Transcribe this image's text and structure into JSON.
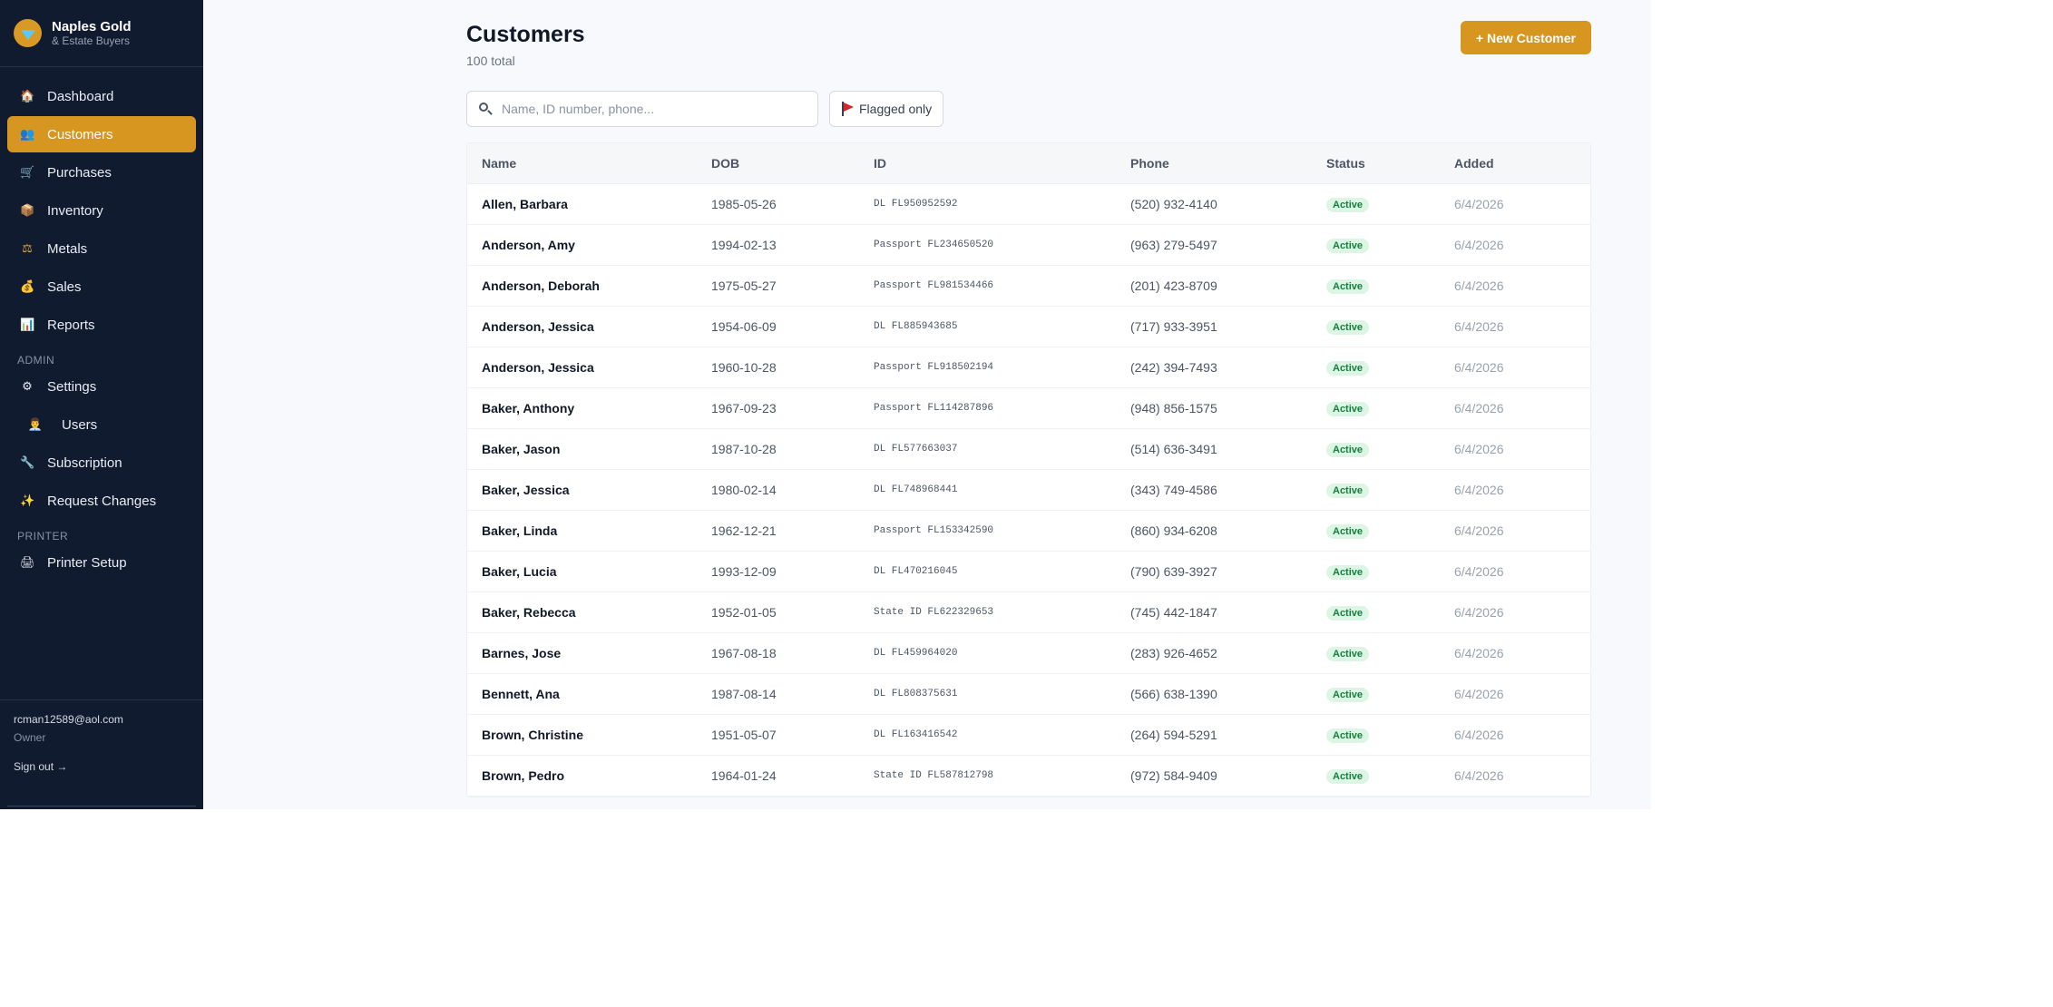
{
  "brand": {
    "name": "Naples Gold",
    "subtitle": "& Estate Buyers"
  },
  "sidebar": {
    "items": [
      {
        "label": "Dashboard",
        "icon": "🏠"
      },
      {
        "label": "Customers",
        "icon": "👥",
        "active": true
      },
      {
        "label": "Purchases",
        "icon": "🛒"
      },
      {
        "label": "Inventory",
        "icon": "📦"
      },
      {
        "label": "Metals",
        "icon": "⚖"
      },
      {
        "label": "Sales",
        "icon": "💰"
      },
      {
        "label": "Reports",
        "icon": "📊"
      }
    ],
    "admin_label": "ADMIN",
    "admin_items": [
      {
        "label": "Settings",
        "icon": "⚙"
      },
      {
        "label": "Users",
        "icon": "👨‍💼"
      },
      {
        "label": "Subscription",
        "icon": "🔧"
      },
      {
        "label": "Request Changes",
        "icon": "✨"
      }
    ],
    "printer_label": "PRINTER",
    "printer_items": [
      {
        "label": "Printer Setup",
        "icon": "🖨"
      }
    ],
    "user": {
      "email": "rcman12589@aol.com",
      "role": "Owner",
      "signout": "Sign out →"
    }
  },
  "page": {
    "title": "Customers",
    "count": "100 total",
    "new_button": "+ New Customer",
    "search_placeholder": "Name, ID number, phone...",
    "flag_filter": "Flagged only"
  },
  "table": {
    "headers": {
      "name": "Name",
      "dob": "DOB",
      "id": "ID",
      "phone": "Phone",
      "status": "Status",
      "added": "Added"
    },
    "rows": [
      {
        "name": "Allen, Barbara",
        "dob": "1985-05-26",
        "id": "DL FL950952592",
        "phone": "(520) 932-4140",
        "status": "Active",
        "added": "6/4/2026"
      },
      {
        "name": "Anderson, Amy",
        "dob": "1994-02-13",
        "id": "Passport FL234650520",
        "phone": "(963) 279-5497",
        "status": "Active",
        "added": "6/4/2026"
      },
      {
        "name": "Anderson, Deborah",
        "dob": "1975-05-27",
        "id": "Passport FL981534466",
        "phone": "(201) 423-8709",
        "status": "Active",
        "added": "6/4/2026"
      },
      {
        "name": "Anderson, Jessica",
        "dob": "1954-06-09",
        "id": "DL FL885943685",
        "phone": "(717) 933-3951",
        "status": "Active",
        "added": "6/4/2026"
      },
      {
        "name": "Anderson, Jessica",
        "dob": "1960-10-28",
        "id": "Passport FL918502194",
        "phone": "(242) 394-7493",
        "status": "Active",
        "added": "6/4/2026"
      },
      {
        "name": "Baker, Anthony",
        "dob": "1967-09-23",
        "id": "Passport FL114287896",
        "phone": "(948) 856-1575",
        "status": "Active",
        "added": "6/4/2026"
      },
      {
        "name": "Baker, Jason",
        "dob": "1987-10-28",
        "id": "DL FL577663037",
        "phone": "(514) 636-3491",
        "status": "Active",
        "added": "6/4/2026"
      },
      {
        "name": "Baker, Jessica",
        "dob": "1980-02-14",
        "id": "DL FL748968441",
        "phone": "(343) 749-4586",
        "status": "Active",
        "added": "6/4/2026"
      },
      {
        "name": "Baker, Linda",
        "dob": "1962-12-21",
        "id": "Passport FL153342590",
        "phone": "(860) 934-6208",
        "status": "Active",
        "added": "6/4/2026"
      },
      {
        "name": "Baker, Lucia",
        "dob": "1993-12-09",
        "id": "DL FL470216045",
        "phone": "(790) 639-3927",
        "status": "Active",
        "added": "6/4/2026"
      },
      {
        "name": "Baker, Rebecca",
        "dob": "1952-01-05",
        "id": "State ID FL622329653",
        "phone": "(745) 442-1847",
        "status": "Active",
        "added": "6/4/2026"
      },
      {
        "name": "Barnes, Jose",
        "dob": "1967-08-18",
        "id": "DL FL459964020",
        "phone": "(283) 926-4652",
        "status": "Active",
        "added": "6/4/2026"
      },
      {
        "name": "Bennett, Ana",
        "dob": "1987-08-14",
        "id": "DL FL808375631",
        "phone": "(566) 638-1390",
        "status": "Active",
        "added": "6/4/2026"
      },
      {
        "name": "Brown, Christine",
        "dob": "1951-05-07",
        "id": "DL FL163416542",
        "phone": "(264) 594-5291",
        "status": "Active",
        "added": "6/4/2026"
      },
      {
        "name": "Brown, Pedro",
        "dob": "1964-01-24",
        "id": "State ID FL587812798",
        "phone": "(972) 584-9409",
        "status": "Active",
        "added": "6/4/2026"
      }
    ]
  }
}
